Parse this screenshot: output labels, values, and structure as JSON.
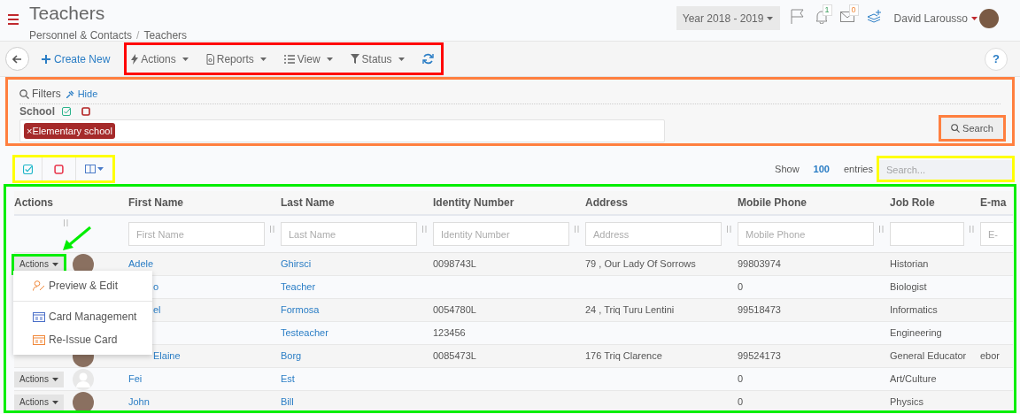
{
  "header": {
    "title": "Teachers",
    "breadcrumbs": [
      "Personnel & Contacts",
      "Teachers"
    ],
    "breadcrumb_separator": "/",
    "year": "Year 2018 - 2019",
    "notifications": "1",
    "messages": "0",
    "user": "David Larousso"
  },
  "toolbar": {
    "create": "Create New",
    "menus": [
      {
        "kind": "actions",
        "label": "Actions"
      },
      {
        "kind": "reports",
        "label": "Reports"
      },
      {
        "kind": "view",
        "label": "View"
      },
      {
        "kind": "status",
        "label": "Status"
      }
    ],
    "help": "?"
  },
  "filters": {
    "title": "Filters",
    "hide": "Hide",
    "field_label": "School",
    "tags": [
      {
        "remove": "×",
        "label": "Elementary school"
      }
    ],
    "search_button": "Search"
  },
  "table_tools": {
    "show": "Show",
    "page_size": "100",
    "entries": "entries",
    "search": {
      "placeholder": "Search..."
    }
  },
  "table": {
    "columns": [
      "Actions",
      "First Name",
      "Last Name",
      "Identity Number",
      "Address",
      "Mobile Phone",
      "Job Role",
      "E-ma"
    ],
    "column_filters": [
      {
        "kind": "text",
        "placeholder": "First Name"
      },
      {
        "kind": "text",
        "placeholder": "Last Name"
      },
      {
        "kind": "text",
        "placeholder": "Identity Number"
      },
      {
        "kind": "text",
        "placeholder": "Address"
      },
      {
        "kind": "text",
        "placeholder": "Mobile Phone"
      },
      {
        "kind": "blank"
      },
      {
        "kind": "text",
        "placeholder": "E-"
      }
    ],
    "rows": [
      {
        "covered": false,
        "action": "Actions",
        "photo": true,
        "first_name": "Adele",
        "last_name": "Ghirsci",
        "identity": "0098743L",
        "address": "79 , Our Lady Of Sorrows",
        "mobile": "99803974",
        "job_role": "Historian"
      },
      {
        "covered": true,
        "first_name": "o",
        "last_name": "Teacher",
        "mobile": "0",
        "job_role": "Biologist"
      },
      {
        "covered": true,
        "first_name": "el",
        "last_name": "Formosa",
        "identity": "0054780L",
        "address": "24 , Triq Turu Lentini",
        "mobile": "99518473",
        "job_role": "Informatics"
      },
      {
        "last_name": "Testeacher",
        "identity": "123456",
        "job_role": "Engineering"
      },
      {
        "covered": true,
        "photo": true,
        "first_name": "Elaine",
        "last_name": "Borg",
        "identity": "0085473L",
        "address": "176 Triq Clarence",
        "mobile": "99524173",
        "job_role": "General Educator",
        "email": "ebor"
      },
      {
        "covered": false,
        "action": "Actions",
        "photo": false,
        "first_name": "Fei",
        "last_name": "Est",
        "mobile": "0",
        "job_role": "Art/Culture"
      },
      {
        "covered": false,
        "action": "Actions",
        "photo": true,
        "first_name": "John",
        "last_name": "Bill",
        "mobile": "0",
        "job_role": "Physics"
      }
    ]
  },
  "row_menu": {
    "items": [
      {
        "kind": "edit",
        "label": "Preview & Edit"
      },
      {
        "kind": "card",
        "label": "Card Management"
      },
      {
        "kind": "reissue",
        "label": "Re-Issue Card"
      }
    ]
  },
  "highlights": [
    {
      "kind": "toolbar",
      "color": "#ff0000"
    },
    {
      "kind": "filters",
      "color": "#ff7f3f"
    },
    {
      "kind": "search_button",
      "color": "#ff7f3f"
    },
    {
      "kind": "table_tools",
      "color": "#ffff00"
    },
    {
      "kind": "table_search",
      "color": "#ffff00"
    },
    {
      "kind": "table",
      "color": "#00ee00"
    },
    {
      "kind": "row_action",
      "color": "#00ee00"
    }
  ]
}
